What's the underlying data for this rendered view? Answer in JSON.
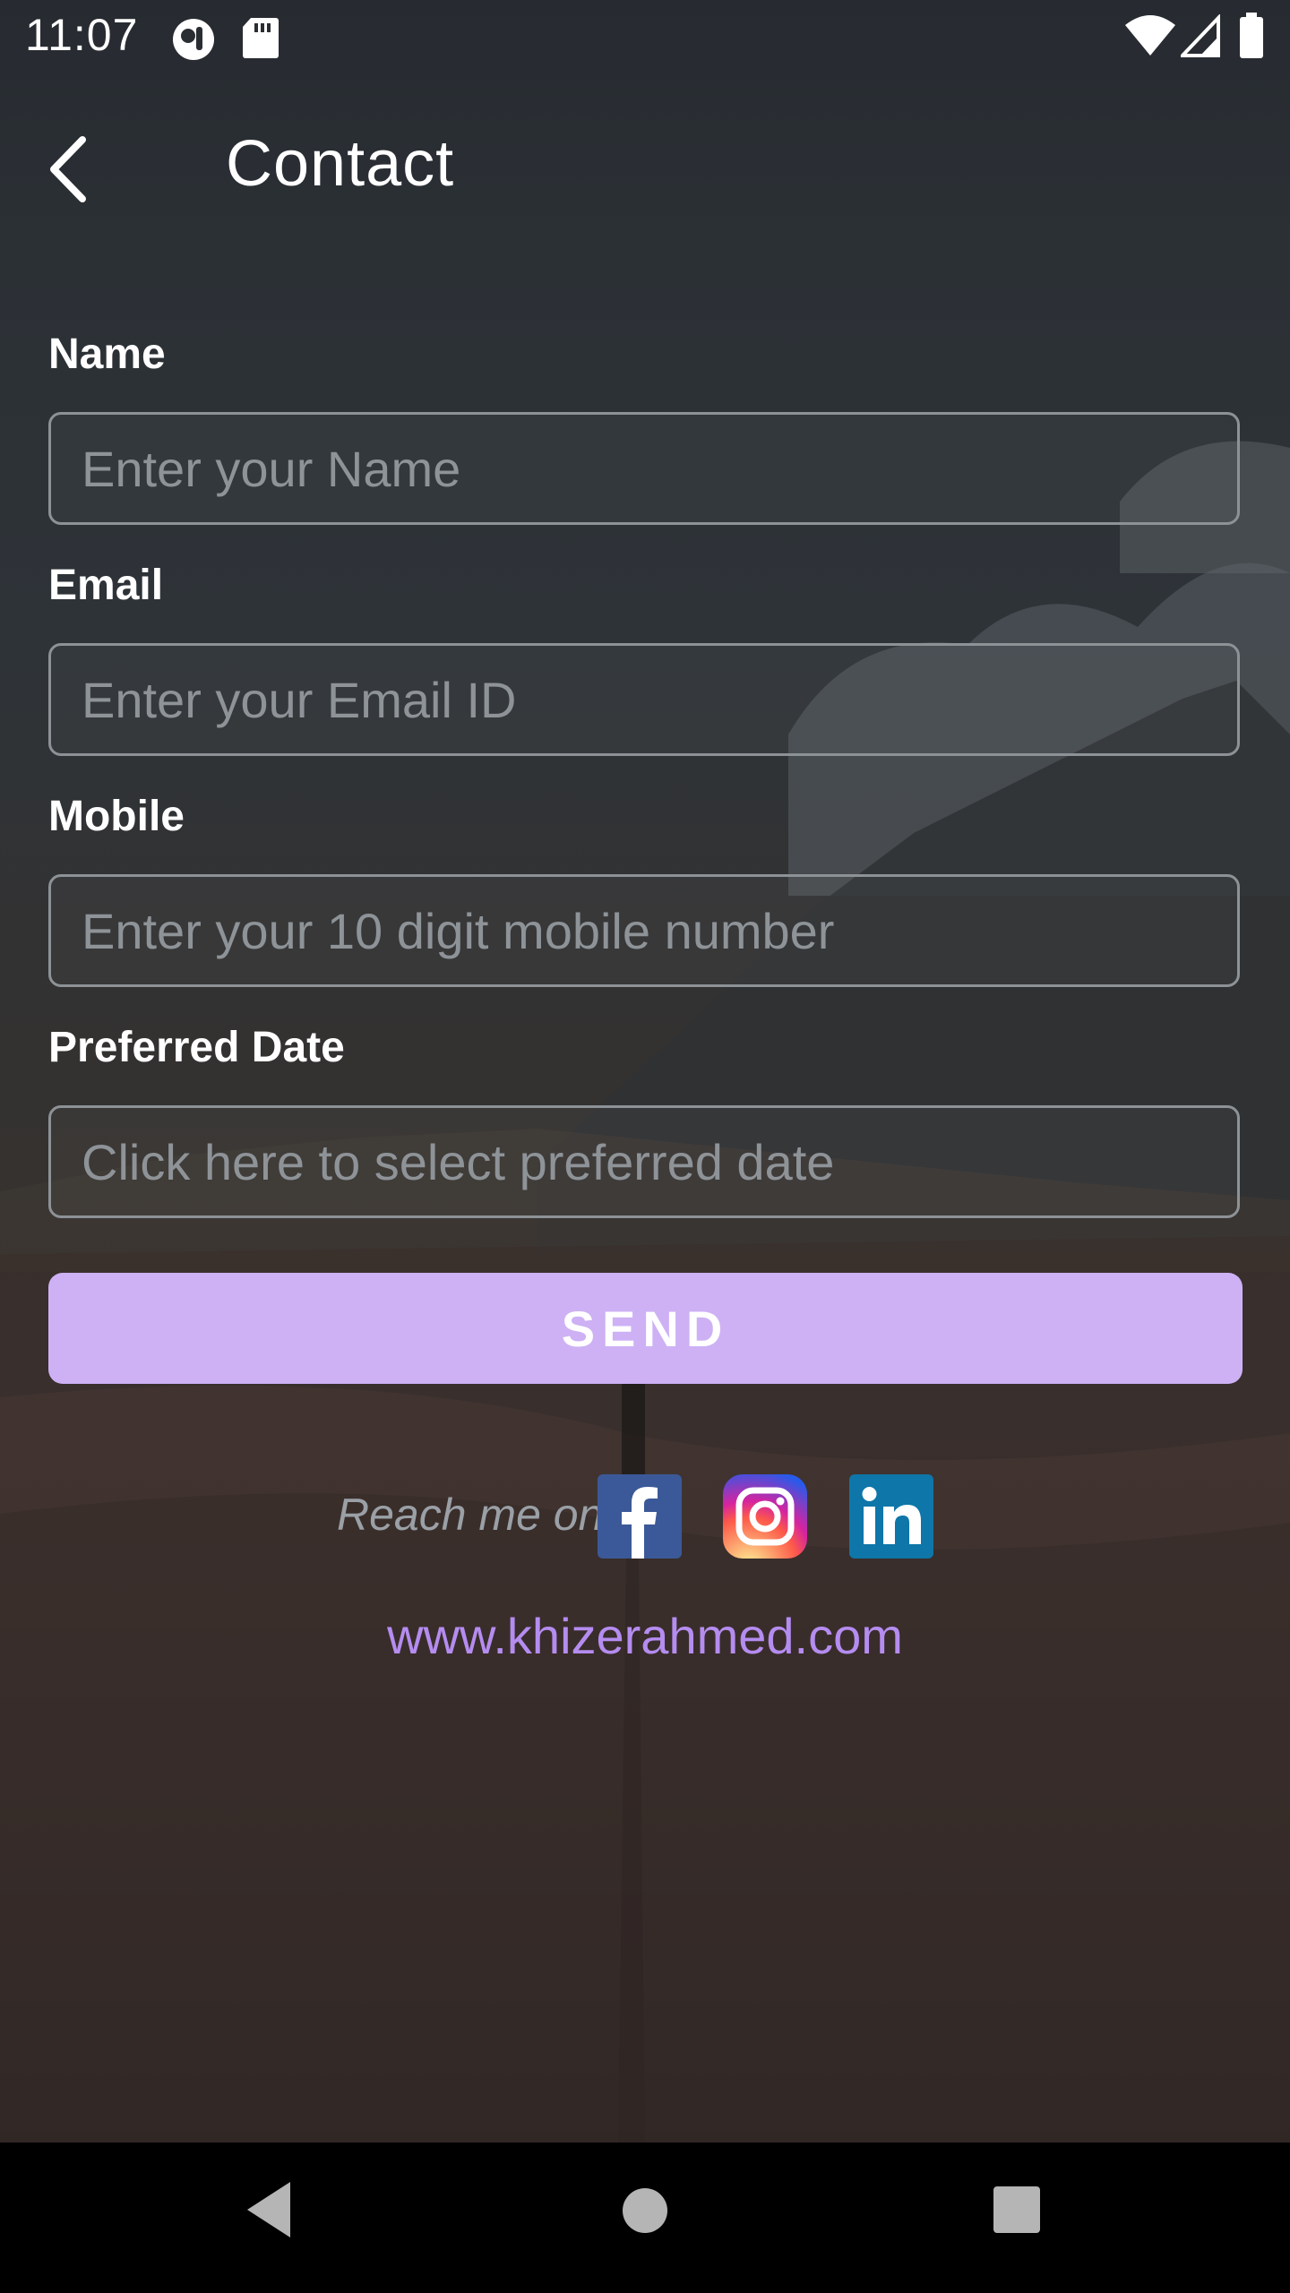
{
  "status_bar": {
    "time": "11:07",
    "icons": [
      "app-notification-icon",
      "sd-card-icon",
      "wifi-icon",
      "signal-icon",
      "battery-icon"
    ]
  },
  "app_bar": {
    "back_icon": "back-arrow-icon",
    "title": "Contact"
  },
  "form": {
    "name": {
      "label": "Name",
      "placeholder": "Enter your Name"
    },
    "email": {
      "label": "Email",
      "placeholder": "Enter your Email ID"
    },
    "mobile": {
      "label": "Mobile",
      "placeholder": "Enter your 10 digit mobile number"
    },
    "date": {
      "label": "Preferred Date",
      "placeholder": "Click here to select preferred date"
    },
    "send_label": "SEND"
  },
  "social": {
    "reach_text": "Reach me on",
    "icons": [
      "facebook-icon",
      "instagram-icon",
      "linkedin-icon"
    ],
    "website": "www.khizerahmed.com"
  },
  "nav_bar": {
    "icons": [
      "back-nav-icon",
      "home-nav-icon",
      "recents-nav-icon"
    ]
  },
  "colors": {
    "accent_button": "#cdb1f4",
    "link": "#b58cf0",
    "facebook": "#3b5998",
    "linkedin": "#0e76a8"
  }
}
